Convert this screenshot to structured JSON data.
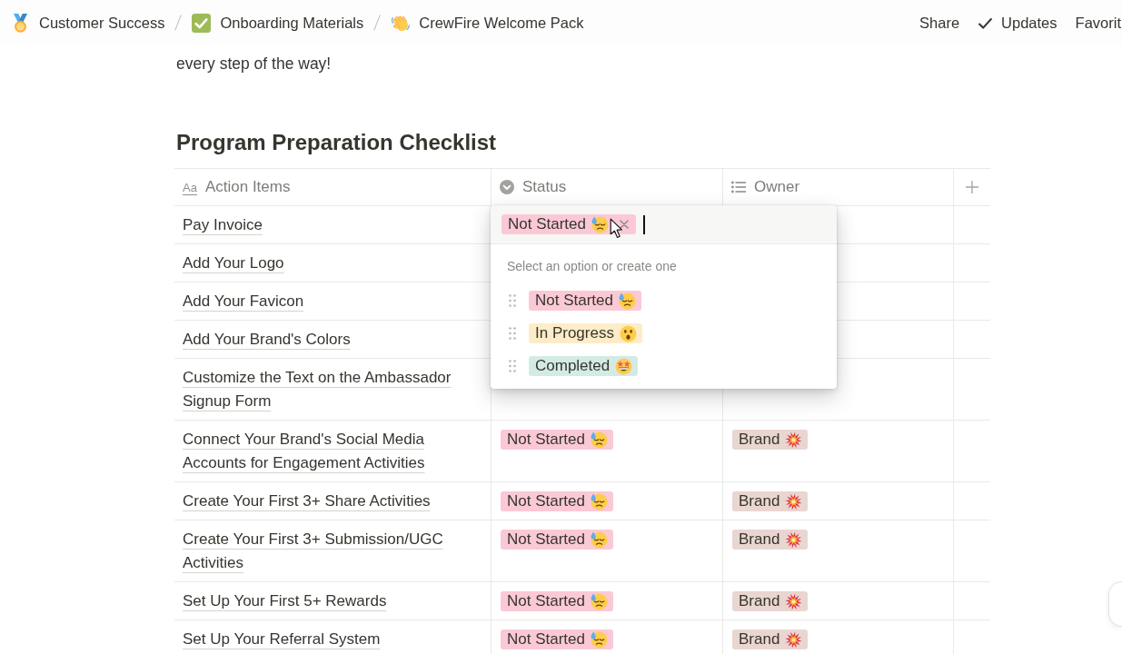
{
  "breadcrumbs": [
    {
      "label": "Customer Success"
    },
    {
      "label": "Onboarding Materials"
    },
    {
      "label": "CrewFire Welcome Pack"
    }
  ],
  "top_actions": [
    {
      "label": "Share",
      "kind": "text"
    },
    {
      "label": "Updates",
      "kind": "check"
    },
    {
      "label": "Favorit",
      "kind": "text"
    }
  ],
  "intro_text": "every step of the way!",
  "database": {
    "title": "Program Preparation Checklist",
    "columns": [
      {
        "kind": "title",
        "icon": "Aa",
        "label": "Action Items"
      },
      {
        "kind": "status",
        "label": "Status"
      },
      {
        "kind": "multi_select",
        "label": "Owner"
      },
      {
        "kind": "add"
      }
    ],
    "rows": [
      {
        "title": "Pay Invoice",
        "editing": true,
        "status": {
          "label": "Not Started",
          "color": "#fbc9d6",
          "kind": "pending"
        }
      },
      {
        "title": "Add Your Logo",
        "editing": false
      },
      {
        "title": "Add Your Favicon",
        "editing": false
      },
      {
        "title": "Add Your Brand's Colors",
        "editing": false
      },
      {
        "title": "Customize the Text on the Ambassador Signup Form",
        "editing": false
      },
      {
        "title": "Connect Your Brand's Social Media Accounts for Engagement Activities",
        "editing": false,
        "status": {
          "label": "Not Started",
          "color": "#fbc9d6",
          "kind": "pending"
        },
        "owner": {
          "label": "Brand",
          "color": "#e9d6d1"
        }
      },
      {
        "title": "Create Your First 3+ Share Activities",
        "editing": false,
        "status": {
          "label": "Not Started",
          "color": "#fbc9d6",
          "kind": "pending"
        },
        "owner": {
          "label": "Brand",
          "color": "#e9d6d1"
        }
      },
      {
        "title": "Create Your First 3+ Submission/UGC Activities",
        "editing": false,
        "status": {
          "label": "Not Started",
          "color": "#fbc9d6",
          "kind": "pending"
        },
        "owner": {
          "label": "Brand",
          "color": "#e9d6d1"
        }
      },
      {
        "title": "Set Up Your First 5+ Rewards",
        "editing": false,
        "status": {
          "label": "Not Started",
          "color": "#fbc9d6",
          "kind": "pending"
        },
        "owner": {
          "label": "Brand",
          "color": "#e9d6d1"
        }
      },
      {
        "title": "Set Up Your Referral System",
        "editing": false,
        "status": {
          "label": "Not Started",
          "color": "#fbc9d6",
          "kind": "pending"
        },
        "owner": {
          "label": "Brand",
          "color": "#e9d6d1"
        }
      }
    ],
    "status_editor": {
      "hint": "Select an option or create one",
      "options": [
        {
          "label": "Not Started",
          "color": "#fbc9d6",
          "kind": "pending"
        },
        {
          "label": "In Progress",
          "color": "#fdecc8",
          "kind": "progress"
        },
        {
          "label": "Completed",
          "color": "#d3ebe5",
          "kind": "done"
        }
      ]
    }
  }
}
